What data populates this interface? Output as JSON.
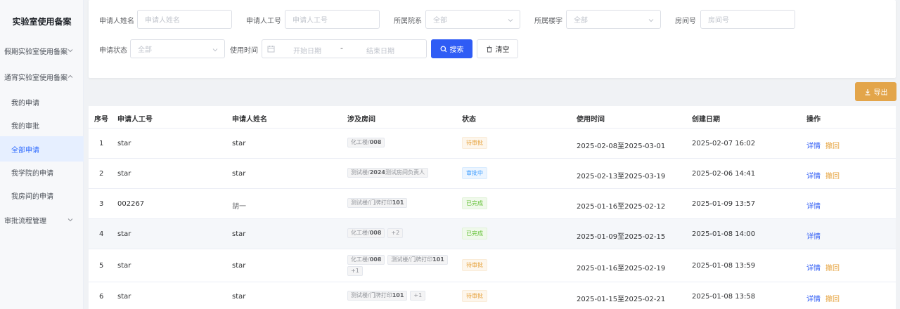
{
  "sidebar": {
    "title": "实验室使用备案",
    "menus": [
      {
        "label": "假期实验室使用备案",
        "chevron": "chevron-down-icon"
      },
      {
        "label": "通宵实验室使用备案",
        "chevron": "chevron-up-icon"
      },
      {
        "label": "审批流程管理",
        "chevron": "chevron-down-icon"
      }
    ],
    "submenu": [
      {
        "label": "我的申请"
      },
      {
        "label": "我的审批"
      },
      {
        "label": "全部申请",
        "active": true
      },
      {
        "label": "我学院的申请"
      },
      {
        "label": "我房间的申请"
      }
    ]
  },
  "filter": {
    "applicant_name_label": "申请人姓名",
    "applicant_name_placeholder": "申请人姓名",
    "applicant_id_label": "申请人工号",
    "applicant_id_placeholder": "申请人工号",
    "college_label": "所属院系",
    "college_value": "全部",
    "building_label": "所属楼宇",
    "building_value": "全部",
    "room_label": "房间号",
    "room_placeholder": "房间号",
    "status_label": "申请状态",
    "status_value": "全部",
    "time_label": "使用时间",
    "start_placeholder": "开始日期",
    "range_separator": "-",
    "end_placeholder": "结束日期",
    "search_label": "搜索",
    "clear_label": "清空"
  },
  "toolbar": {
    "export_label": "导出"
  },
  "table": {
    "headers": [
      "序号",
      "申请人工号",
      "申请人姓名",
      "涉及房间",
      "状态",
      "使用时间",
      "创建日期",
      "操作"
    ],
    "detail_label": "详情",
    "revoke_label": "撤回",
    "rows": [
      {
        "no": "1",
        "emp_id": "star",
        "name": "star",
        "rooms": [
          {
            "building": "化工楼",
            "room": "008"
          }
        ],
        "more": "",
        "status": "待审批",
        "status_type": "wait",
        "start": "2025-02-08",
        "to": "至",
        "end": "2025-03-01",
        "created": "2025-02-07 16:02",
        "revoke": true
      },
      {
        "no": "2",
        "emp_id": "star",
        "name": "star",
        "rooms": [
          {
            "building": "测试楼",
            "room": "2024",
            "suffix": "测试房间负责人"
          }
        ],
        "more": "",
        "status": "审批中",
        "status_type": "ing",
        "start": "2025-02-13",
        "to": "至",
        "end": "2025-03-19",
        "created": "2025-02-06 14:41",
        "revoke": true
      },
      {
        "no": "3",
        "emp_id": "002267",
        "name": "胡一",
        "rooms": [
          {
            "building": "测试楼",
            "room": "门牌打印",
            "num": "101"
          }
        ],
        "more": "",
        "status": "已完成",
        "status_type": "done",
        "start": "2025-01-16",
        "to": "至",
        "end": "2025-02-12",
        "created": "2025-01-09 13:57",
        "revoke": false
      },
      {
        "no": "4",
        "emp_id": "star",
        "name": "star",
        "rooms": [
          {
            "building": "化工楼",
            "room": "008"
          }
        ],
        "more": "+2",
        "status": "已完成",
        "status_type": "done",
        "start": "2025-01-09",
        "to": "至",
        "end": "2025-02-15",
        "created": "2025-01-08 14:00",
        "revoke": false
      },
      {
        "no": "5",
        "emp_id": "star",
        "name": "star",
        "rooms": [
          {
            "building": "化工楼",
            "room": "008"
          },
          {
            "building": "测试楼",
            "room": "门牌打印",
            "num": "101"
          }
        ],
        "more": "+1",
        "status": "待审批",
        "status_type": "wait",
        "start": "2025-01-16",
        "to": "至",
        "end": "2025-02-19",
        "created": "2025-01-08 13:59",
        "revoke": true
      },
      {
        "no": "6",
        "emp_id": "star",
        "name": "star",
        "rooms": [
          {
            "building": "测试楼",
            "room": "门牌打印",
            "num": "101"
          }
        ],
        "more": "+1",
        "status": "待审批",
        "status_type": "wait",
        "start": "2025-01-15",
        "to": "至",
        "end": "2025-02-21",
        "created": "2025-01-08 13:58",
        "revoke": true
      }
    ]
  },
  "colors": {
    "primary": "#2f5cf5",
    "export": "#e3a54a",
    "wait": "#e6a23c",
    "ing": "#409eff",
    "done": "#67c23a",
    "active_menu_bg": "#e6efff"
  },
  "icons": {
    "search": "search-icon",
    "clear": "trash-icon",
    "export": "download-icon",
    "date": "calendar-icon"
  }
}
